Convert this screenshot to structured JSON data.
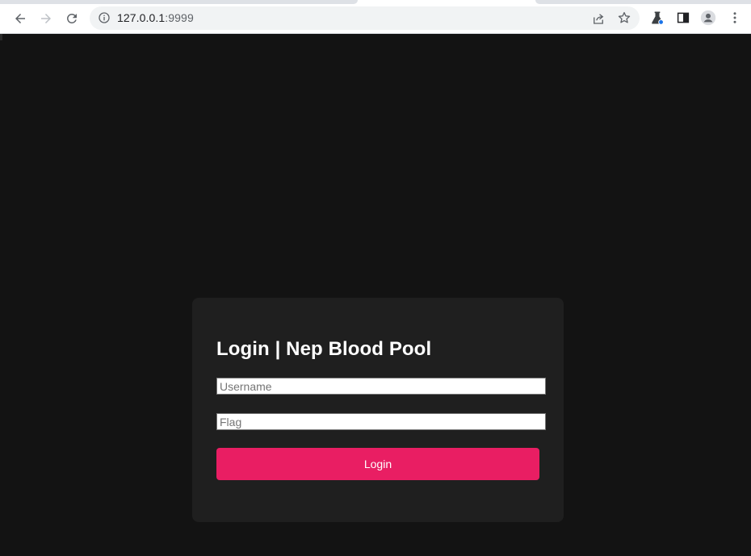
{
  "browser": {
    "url_host": "127.0.0.1",
    "url_port": ":9999",
    "icons": [
      "back-icon",
      "forward-icon",
      "reload-icon",
      "site-info-icon",
      "share-icon",
      "bookmark-star-icon",
      "labs-flask-icon",
      "side-panel-icon",
      "profile-avatar-icon",
      "menu-icon"
    ]
  },
  "login": {
    "title": "Login | Nep Blood Pool",
    "username_placeholder": "Username",
    "flag_placeholder": "Flag",
    "button_label": "Login"
  },
  "colors": {
    "page_bg": "#131313",
    "card_bg": "#1f1f1f",
    "accent": "#e91e63"
  }
}
